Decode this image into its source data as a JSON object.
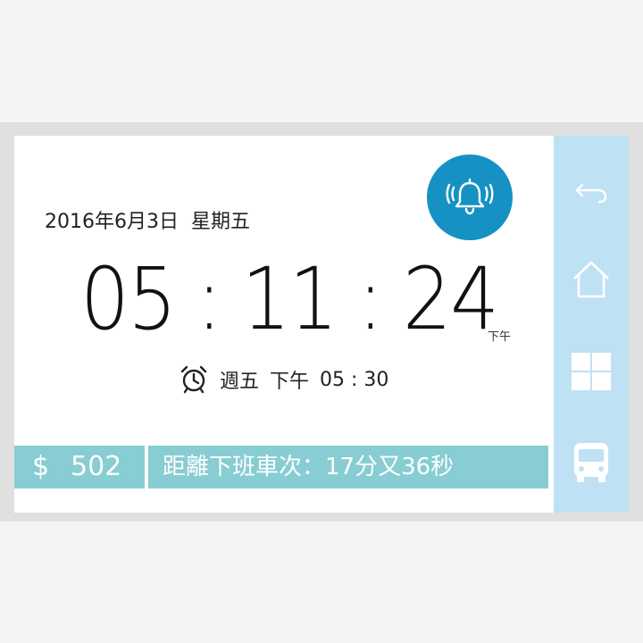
{
  "header": {
    "date": "2016年6月3日",
    "weekday": "星期五"
  },
  "clock": {
    "hours": "05",
    "minutes": "11",
    "seconds": "24",
    "separator": ":",
    "period": "下午"
  },
  "alarm": {
    "day": "週五",
    "period": "下午",
    "time": "05 : 30"
  },
  "balance": {
    "symbol": "$",
    "amount": "502"
  },
  "bus_info": {
    "text": "距離下班車次：17分又36秒"
  },
  "sidebar": {
    "items": [
      {
        "icon": "back-arrow-icon"
      },
      {
        "icon": "home-icon"
      },
      {
        "icon": "windows-grid-icon"
      },
      {
        "icon": "bus-icon"
      }
    ]
  },
  "colors": {
    "accent_blue": "#1592c3",
    "teal_bar": "#87cdd3",
    "sidebar_bg": "#bfe1f4",
    "icon_white": "#ffffff"
  }
}
